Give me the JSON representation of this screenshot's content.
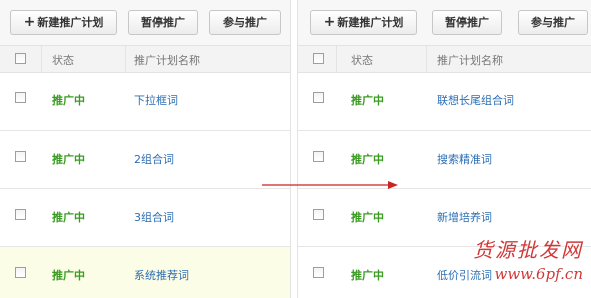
{
  "toolbar": {
    "new_plan_label": "新建推广计划",
    "pause_label": "暂停推广",
    "join_label": "参与推广"
  },
  "table_header": {
    "status_label": "状态",
    "plan_name_label": "推广计划名称"
  },
  "left_rows": [
    {
      "status": "推广中",
      "name": "下拉框词"
    },
    {
      "status": "推广中",
      "name": "2组合词"
    },
    {
      "status": "推广中",
      "name": "3组合词"
    },
    {
      "status": "推广中",
      "name": "系统推荐词"
    }
  ],
  "right_rows": [
    {
      "status": "推广中",
      "name": "联想长尾组合词"
    },
    {
      "status": "推广中",
      "name": "搜索精准词"
    },
    {
      "status": "推广中",
      "name": "新增培养词"
    },
    {
      "status": "推广中",
      "name": "低价引流词"
    }
  ],
  "watermark": {
    "title": "货源批发网",
    "url": "www.6pf.cn"
  },
  "colors": {
    "status_green": "#3a9b22",
    "link_blue": "#2b6eb3",
    "arrow_red": "#cc2222",
    "highlight_row": "#fcfde6",
    "watermark_red": "#d23838"
  },
  "icons": {
    "plus": "plus-icon",
    "arrow": "right-arrow-icon"
  }
}
